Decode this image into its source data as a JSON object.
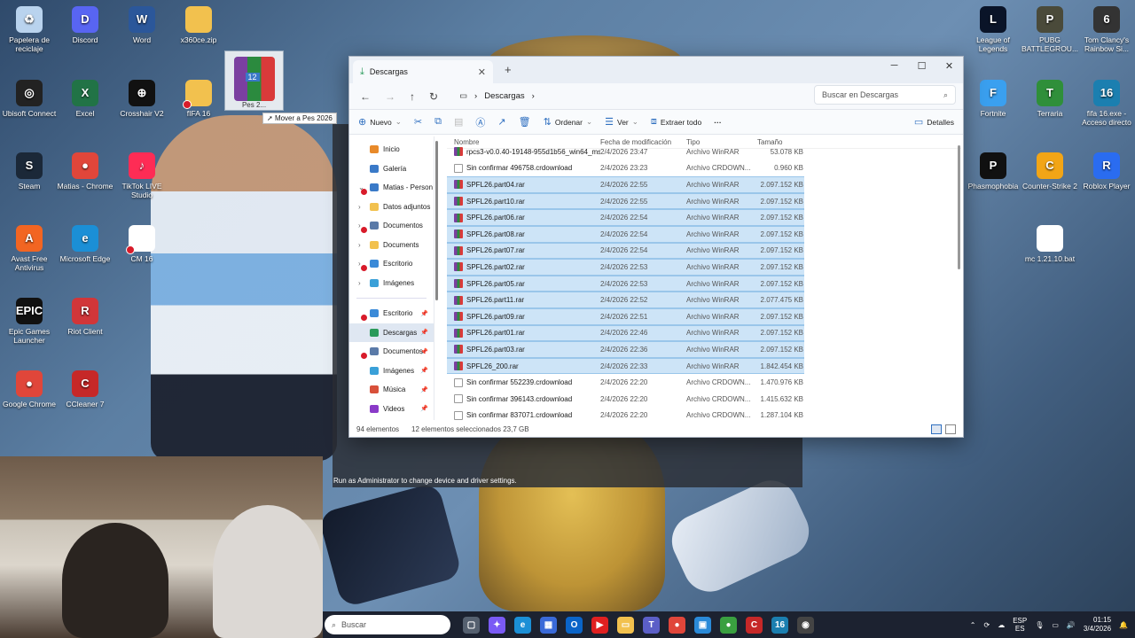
{
  "desktop": {
    "left_icons": [
      {
        "label": "Papelera de reciclaje",
        "icon": "recycle-bin-icon",
        "color": "#b9d3ee",
        "glyph": "♻"
      },
      {
        "label": "Discord",
        "icon": "discord-icon",
        "color": "#5865f2",
        "glyph": "D"
      },
      {
        "label": "Word",
        "icon": "word-icon",
        "color": "#2b579a",
        "glyph": "W"
      },
      {
        "label": "x360ce.zip",
        "icon": "zip-folder-icon",
        "color": "#f2c14e",
        "glyph": ""
      },
      {
        "label": "Ubisoft Connect",
        "icon": "ubisoft-icon",
        "color": "#222",
        "glyph": "◎"
      },
      {
        "label": "Excel",
        "icon": "excel-icon",
        "color": "#217346",
        "glyph": "X"
      },
      {
        "label": "Crosshair V2",
        "icon": "crosshair-icon",
        "color": "#111",
        "glyph": "⊕"
      },
      {
        "label": "fIFA 16",
        "icon": "folder-icon",
        "color": "#f2c14e",
        "glyph": ""
      },
      {
        "label": "Steam",
        "icon": "steam-icon",
        "color": "#1b2838",
        "glyph": "S"
      },
      {
        "label": "Matias - Chrome",
        "icon": "chrome-icon",
        "color": "#e0463a",
        "glyph": "●"
      },
      {
        "label": "TikTok LIVE Studio",
        "icon": "tiktok-icon",
        "color": "#fe2c55",
        "glyph": "♪"
      },
      {
        "label": "Avast Free Antivirus",
        "icon": "avast-icon",
        "color": "#f26522",
        "glyph": "A"
      },
      {
        "label": "Microsoft Edge",
        "icon": "edge-icon",
        "color": "#1b8fd6",
        "glyph": "e"
      },
      {
        "label": "CM 16",
        "icon": "file-icon",
        "color": "#ffffff",
        "glyph": ""
      },
      {
        "label": "Epic Games Launcher",
        "icon": "epic-icon",
        "color": "#111",
        "glyph": "EPIC"
      },
      {
        "label": "Riot Client",
        "icon": "riot-icon",
        "color": "#d13639",
        "glyph": "R"
      },
      {
        "label": "Google Chrome",
        "icon": "chrome-icon",
        "color": "#e0463a",
        "glyph": "●"
      },
      {
        "label": "CCleaner 7",
        "icon": "ccleaner-icon",
        "color": "#c62828",
        "glyph": "C"
      }
    ],
    "right_icons": [
      {
        "label": "League of Legends",
        "icon": "lol-icon",
        "color": "#0a1428",
        "glyph": "L"
      },
      {
        "label": "PUBG BATTLEGROU...",
        "icon": "pubg-icon",
        "color": "#4a4a3a",
        "glyph": "P"
      },
      {
        "label": "Tom Clancy's Rainbow Si...",
        "icon": "r6-icon",
        "color": "#333",
        "glyph": "6"
      },
      {
        "label": "Fortnite",
        "icon": "fortnite-icon",
        "color": "#3aa0f0",
        "glyph": "F"
      },
      {
        "label": "Terraria",
        "icon": "terraria-icon",
        "color": "#2f8f3a",
        "glyph": "T"
      },
      {
        "label": "fifa 16.exe - Acceso directo",
        "icon": "fifa-icon",
        "color": "#1b7fb0",
        "glyph": "16"
      },
      {
        "label": "Phasmophobia",
        "icon": "phasmo-icon",
        "color": "#111",
        "glyph": "P"
      },
      {
        "label": "Counter-Strike 2",
        "icon": "cs2-icon",
        "color": "#f2a516",
        "glyph": "C"
      },
      {
        "label": "Roblox Player",
        "icon": "roblox-icon",
        "color": "#2a6cf0",
        "glyph": "R"
      },
      {
        "label": "mc 1.21.10.bat",
        "icon": "bat-file-icon",
        "color": "#ffffff",
        "glyph": ""
      }
    ],
    "dragged_icon_label": "Pes 2...",
    "tooltip": "Mover a Pes 2026"
  },
  "explorer": {
    "tab_title": "Descargas",
    "breadcrumb": "Descargas",
    "search_placeholder": "Buscar en Descargas",
    "commands": {
      "new": "Nuevo",
      "sort": "Ordenar",
      "view": "Ver",
      "extract": "Extraer todo",
      "details": "Detalles"
    },
    "nav": [
      {
        "label": "Inicio",
        "color": "#e88a2a",
        "chev": "",
        "pin": false,
        "err": false
      },
      {
        "label": "Galería",
        "color": "#3a7ac8",
        "chev": "",
        "pin": false,
        "err": false
      },
      {
        "label": "Matias - Person",
        "color": "#3a7ac8",
        "chev": "⌄",
        "pin": false,
        "err": true
      },
      {
        "label": "Datos adjuntos",
        "color": "#f2c14e",
        "chev": "›",
        "pin": false,
        "err": false
      },
      {
        "label": "Documentos",
        "color": "#5a7aa8",
        "chev": "›",
        "pin": false,
        "err": true
      },
      {
        "label": "Documents",
        "color": "#f2c14e",
        "chev": "›",
        "pin": false,
        "err": false
      },
      {
        "label": "Escritorio",
        "color": "#3a8ad8",
        "chev": "›",
        "pin": false,
        "err": true
      },
      {
        "label": "Imágenes",
        "color": "#3aa0d8",
        "chev": "›",
        "pin": false,
        "err": false
      },
      {
        "label": "Escritorio",
        "color": "#3a8ad8",
        "chev": "",
        "pin": true,
        "err": true
      },
      {
        "label": "Descargas",
        "color": "#2a9a5a",
        "chev": "",
        "pin": true,
        "err": false,
        "sel": true
      },
      {
        "label": "Documentos",
        "color": "#5a7aa8",
        "chev": "",
        "pin": true,
        "err": true
      },
      {
        "label": "Imágenes",
        "color": "#3aa0d8",
        "chev": "",
        "pin": true,
        "err": false
      },
      {
        "label": "Música",
        "color": "#d8503a",
        "chev": "",
        "pin": true,
        "err": false
      },
      {
        "label": "Videos",
        "color": "#8a3ac8",
        "chev": "",
        "pin": true,
        "err": false
      }
    ],
    "columns": {
      "name": "Nombre",
      "date": "Fecha de modificación",
      "type": "Tipo",
      "size": "Tamaño"
    },
    "files": [
      {
        "name": "rpcs3-v0.0.40-19148-955d1b56_win64_ms...",
        "date": "2/4/2026 23:47",
        "type": "Archivo WinRAR",
        "size": "53.078 KB",
        "kind": "rar",
        "sel": false
      },
      {
        "name": "Sin confirmar 496758.crdownload",
        "date": "2/4/2026 23:23",
        "type": "Archivo CRDOWN...",
        "size": "0.960 KB",
        "kind": "doc",
        "sel": false
      },
      {
        "name": "SPFL26.part04.rar",
        "date": "2/4/2026 22:55",
        "type": "Archivo WinRAR",
        "size": "2.097.152 KB",
        "kind": "rar",
        "sel": true
      },
      {
        "name": "SPFL26.part10.rar",
        "date": "2/4/2026 22:55",
        "type": "Archivo WinRAR",
        "size": "2.097.152 KB",
        "kind": "rar",
        "sel": true
      },
      {
        "name": "SPFL26.part06.rar",
        "date": "2/4/2026 22:54",
        "type": "Archivo WinRAR",
        "size": "2.097.152 KB",
        "kind": "rar",
        "sel": true
      },
      {
        "name": "SPFL26.part08.rar",
        "date": "2/4/2026 22:54",
        "type": "Archivo WinRAR",
        "size": "2.097.152 KB",
        "kind": "rar",
        "sel": true
      },
      {
        "name": "SPFL26.part07.rar",
        "date": "2/4/2026 22:54",
        "type": "Archivo WinRAR",
        "size": "2.097.152 KB",
        "kind": "rar",
        "sel": true
      },
      {
        "name": "SPFL26.part02.rar",
        "date": "2/4/2026 22:53",
        "type": "Archivo WinRAR",
        "size": "2.097.152 KB",
        "kind": "rar",
        "sel": true
      },
      {
        "name": "SPFL26.part05.rar",
        "date": "2/4/2026 22:53",
        "type": "Archivo WinRAR",
        "size": "2.097.152 KB",
        "kind": "rar",
        "sel": true
      },
      {
        "name": "SPFL26.part11.rar",
        "date": "2/4/2026 22:52",
        "type": "Archivo WinRAR",
        "size": "2.077.475 KB",
        "kind": "rar",
        "sel": true
      },
      {
        "name": "SPFL26.part09.rar",
        "date": "2/4/2026 22:51",
        "type": "Archivo WinRAR",
        "size": "2.097.152 KB",
        "kind": "rar",
        "sel": true
      },
      {
        "name": "SPFL26.part01.rar",
        "date": "2/4/2026 22:46",
        "type": "Archivo WinRAR",
        "size": "2.097.152 KB",
        "kind": "rar",
        "sel": true
      },
      {
        "name": "SPFL26.part03.rar",
        "date": "2/4/2026 22:36",
        "type": "Archivo WinRAR",
        "size": "2.097.152 KB",
        "kind": "rar",
        "sel": true
      },
      {
        "name": "SPFL26_200.rar",
        "date": "2/4/2026 22:33",
        "type": "Archivo WinRAR",
        "size": "1.842.454 KB",
        "kind": "rar",
        "sel": true
      },
      {
        "name": "Sin confirmar 552239.crdownload",
        "date": "2/4/2026 22:20",
        "type": "Archivo CRDOWN...",
        "size": "1.470.976 KB",
        "kind": "doc",
        "sel": false
      },
      {
        "name": "Sin confirmar 396143.crdownload",
        "date": "2/4/2026 22:20",
        "type": "Archivo CRDOWN...",
        "size": "1.415.632 KB",
        "kind": "doc",
        "sel": false
      },
      {
        "name": "Sin confirmar 837071.crdownload",
        "date": "2/4/2026 22:20",
        "type": "Archivo CRDOWN...",
        "size": "1.287.104 KB",
        "kind": "doc",
        "sel": false
      }
    ],
    "status": {
      "count": "94 elementos",
      "selected": "12 elementos seleccionados  23,7 GB"
    }
  },
  "background_window_note": "Run as Administrator to change device and driver settings.",
  "taskbar": {
    "search_placeholder": "Buscar",
    "apps": [
      {
        "icon": "task-view-icon",
        "color": "#55606f",
        "glyph": "▢"
      },
      {
        "icon": "copilot-icon",
        "color": "#7a5af5",
        "glyph": "✦"
      },
      {
        "icon": "edge-icon",
        "color": "#1b8fd6",
        "glyph": "e"
      },
      {
        "icon": "store-icon",
        "color": "#3a6ad8",
        "glyph": "▦"
      },
      {
        "icon": "outlook-icon",
        "color": "#0a64c8",
        "glyph": "O"
      },
      {
        "icon": "youtube-icon",
        "color": "#e02020",
        "glyph": "▶"
      },
      {
        "icon": "file-explorer-icon",
        "color": "#f2c14e",
        "glyph": "▭"
      },
      {
        "icon": "teams-icon",
        "color": "#5b5fc7",
        "glyph": "T"
      },
      {
        "icon": "chrome-icon",
        "color": "#e0463a",
        "glyph": "●"
      },
      {
        "icon": "photos-icon",
        "color": "#2a8ad8",
        "glyph": "▣"
      },
      {
        "icon": "chrome-icon",
        "color": "#3aa040",
        "glyph": "●"
      },
      {
        "icon": "ccleaner-icon",
        "color": "#c62828",
        "glyph": "C"
      },
      {
        "icon": "fifa-icon",
        "color": "#1b7fb0",
        "glyph": "16"
      },
      {
        "icon": "app-icon",
        "color": "#444",
        "glyph": "◉"
      }
    ],
    "lang_top": "ESP",
    "lang_bottom": "ES",
    "time": "01:15",
    "date": "3/4/2026"
  }
}
